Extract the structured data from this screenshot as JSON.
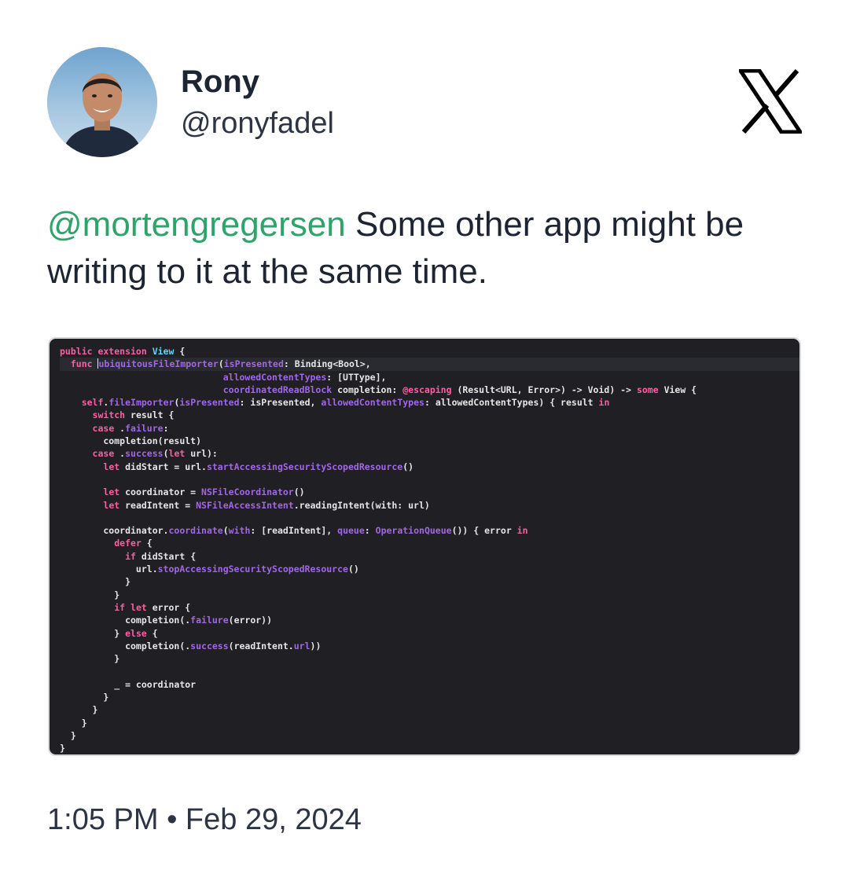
{
  "author": {
    "name": "Rony",
    "handle": "@ronyfadel"
  },
  "platform": {
    "icon": "x-logo-icon"
  },
  "tweet": {
    "mention": "@mortengregersen",
    "text": " Some other app might be writing to it at the same time."
  },
  "code_lines": [
    [
      [
        "kw",
        "public extension "
      ],
      [
        "ty",
        "View"
      ],
      [
        "pl",
        " {"
      ]
    ],
    [
      [
        "pl",
        "  "
      ],
      [
        "kw",
        "func "
      ],
      [
        "pl",
        "CURSOR"
      ],
      [
        "fn",
        "ubiquitousFileImporter"
      ],
      [
        "pl",
        "("
      ],
      [
        "fn",
        "isPresented"
      ],
      [
        "pl",
        ": Binding<Bool>,"
      ]
    ],
    [
      [
        "pl",
        "                              "
      ],
      [
        "fn",
        "allowedContentTypes"
      ],
      [
        "pl",
        ": [UTType],"
      ]
    ],
    [
      [
        "pl",
        "                              "
      ],
      [
        "fn",
        "coordinatedReadBlock"
      ],
      [
        "pl",
        " completion: "
      ],
      [
        "kw",
        "@escaping"
      ],
      [
        "pl",
        " (Result<URL, Error>) -> Void) -> "
      ],
      [
        "kw",
        "some"
      ],
      [
        "pl",
        " View {"
      ]
    ],
    [
      [
        "pl",
        "    "
      ],
      [
        "kw",
        "self"
      ],
      [
        "pl",
        "."
      ],
      [
        "fn",
        "fileImporter"
      ],
      [
        "pl",
        "("
      ],
      [
        "fn",
        "isPresented"
      ],
      [
        "pl",
        ": isPresented, "
      ],
      [
        "fn",
        "allowedContentTypes"
      ],
      [
        "pl",
        ": allowedContentTypes) { result "
      ],
      [
        "kw",
        "in"
      ]
    ],
    [
      [
        "pl",
        "      "
      ],
      [
        "kw",
        "switch"
      ],
      [
        "pl",
        " result {"
      ]
    ],
    [
      [
        "pl",
        "      "
      ],
      [
        "kw",
        "case"
      ],
      [
        "pl",
        " ."
      ],
      [
        "fn",
        "failure"
      ],
      [
        "pl",
        ":"
      ]
    ],
    [
      [
        "pl",
        "        completion(result)"
      ]
    ],
    [
      [
        "pl",
        "      "
      ],
      [
        "kw",
        "case"
      ],
      [
        "pl",
        " ."
      ],
      [
        "fn",
        "success"
      ],
      [
        "pl",
        "("
      ],
      [
        "kw",
        "let"
      ],
      [
        "pl",
        " url):"
      ]
    ],
    [
      [
        "pl",
        "        "
      ],
      [
        "kw",
        "let"
      ],
      [
        "pl",
        " didStart = url."
      ],
      [
        "fn",
        "startAccessingSecurityScopedResource"
      ],
      [
        "pl",
        "()"
      ]
    ],
    [
      [
        "pl",
        ""
      ]
    ],
    [
      [
        "pl",
        "        "
      ],
      [
        "kw",
        "let"
      ],
      [
        "pl",
        " coordinator = "
      ],
      [
        "fn",
        "NSFileCoordinator"
      ],
      [
        "pl",
        "()"
      ]
    ],
    [
      [
        "pl",
        "        "
      ],
      [
        "kw",
        "let"
      ],
      [
        "pl",
        " readIntent = "
      ],
      [
        "fn",
        "NSFileAccessIntent"
      ],
      [
        "pl",
        ".readingIntent(with: url)"
      ]
    ],
    [
      [
        "pl",
        ""
      ]
    ],
    [
      [
        "pl",
        "        coordinator."
      ],
      [
        "fn",
        "coordinate"
      ],
      [
        "pl",
        "("
      ],
      [
        "fn",
        "with"
      ],
      [
        "pl",
        ": [readIntent], "
      ],
      [
        "fn",
        "queue"
      ],
      [
        "pl",
        ": "
      ],
      [
        "fn",
        "OperationQueue"
      ],
      [
        "pl",
        "()) { error "
      ],
      [
        "kw",
        "in"
      ]
    ],
    [
      [
        "pl",
        "          "
      ],
      [
        "kw",
        "defer"
      ],
      [
        "pl",
        " {"
      ]
    ],
    [
      [
        "pl",
        "            "
      ],
      [
        "kw",
        "if"
      ],
      [
        "pl",
        " didStart {"
      ]
    ],
    [
      [
        "pl",
        "              url."
      ],
      [
        "fn",
        "stopAccessingSecurityScopedResource"
      ],
      [
        "pl",
        "()"
      ]
    ],
    [
      [
        "pl",
        "            }"
      ]
    ],
    [
      [
        "pl",
        "          }"
      ]
    ],
    [
      [
        "pl",
        "          "
      ],
      [
        "kw",
        "if let"
      ],
      [
        "pl",
        " error {"
      ]
    ],
    [
      [
        "pl",
        "            completion(."
      ],
      [
        "fn",
        "failure"
      ],
      [
        "pl",
        "(error))"
      ]
    ],
    [
      [
        "pl",
        "          } "
      ],
      [
        "kw",
        "else"
      ],
      [
        "pl",
        " {"
      ]
    ],
    [
      [
        "pl",
        "            completion(."
      ],
      [
        "fn",
        "success"
      ],
      [
        "pl",
        "(readIntent."
      ],
      [
        "fn",
        "url"
      ],
      [
        "pl",
        "))"
      ]
    ],
    [
      [
        "pl",
        "          }"
      ]
    ],
    [
      [
        "pl",
        ""
      ]
    ],
    [
      [
        "pl",
        "          _ = coordinator"
      ]
    ],
    [
      [
        "pl",
        "        }"
      ]
    ],
    [
      [
        "pl",
        "      }"
      ]
    ],
    [
      [
        "pl",
        "    }"
      ]
    ],
    [
      [
        "pl",
        "  }"
      ]
    ],
    [
      [
        "pl",
        "}"
      ]
    ]
  ],
  "timestamp": "1:05 PM • Feb 29, 2024"
}
